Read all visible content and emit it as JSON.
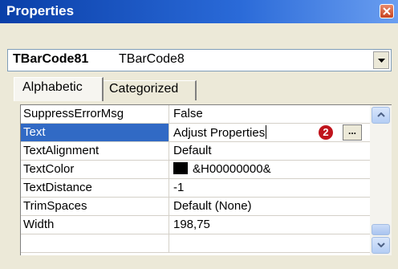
{
  "window": {
    "title": "Properties"
  },
  "object_selector": {
    "name": "TBarCode81",
    "type": "TBarCode8"
  },
  "tabs": [
    {
      "label": "Alphabetic",
      "active": true
    },
    {
      "label": "Categorized",
      "active": false
    }
  ],
  "properties": [
    {
      "name": "SuppressErrorMsg",
      "value": "False"
    },
    {
      "name": "Text",
      "value": "Adjust Properties",
      "selected": true
    },
    {
      "name": "TextAlignment",
      "value": "Default"
    },
    {
      "name": "TextColor",
      "value": "&H00000000&",
      "swatch_color": "#000000"
    },
    {
      "name": "TextDistance",
      "value": "-1"
    },
    {
      "name": "TrimSpaces",
      "value": "Default (None)"
    },
    {
      "name": "Width",
      "value": "198,75"
    }
  ],
  "annotation": {
    "callout_number": "2"
  },
  "ellipsis_label": "...",
  "colors": {
    "title_bar": "#0a3fa8",
    "selection": "#316ac5",
    "callout": "#c0141c"
  }
}
